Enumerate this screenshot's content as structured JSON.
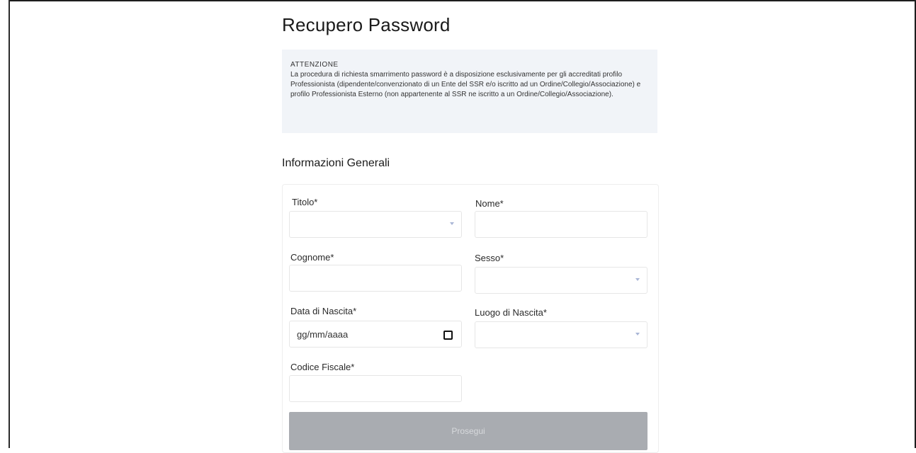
{
  "page": {
    "title": "Recupero Password"
  },
  "alert": {
    "title": "ATTENZIONE",
    "text": "La procedura di richiesta smarrimento password è a disposizione esclusivamente per gli accreditati profilo Professionista (dipendente/convenzionato di un Ente del SSR e/o iscritto ad un Ordine/Collegio/Associazione) e profilo Professionista Esterno (non appartenente al SSR ne iscritto a un Ordine/Collegio/Associazione)."
  },
  "section": {
    "title": "Informazioni Generali"
  },
  "form": {
    "titolo": {
      "label": "Titolo*",
      "value": ""
    },
    "nome": {
      "label": "Nome*",
      "value": ""
    },
    "cognome": {
      "label": "Cognome*",
      "value": ""
    },
    "sesso": {
      "label": "Sesso*",
      "value": ""
    },
    "data_nascita": {
      "label": "Data di Nascita*",
      "value": "gg/mm/aaaa"
    },
    "luogo_nascita": {
      "label": "Luogo di Nascita*",
      "value": ""
    },
    "codice_fiscale": {
      "label": "Codice Fiscale*",
      "value": ""
    },
    "submit_label": "Prosegui"
  },
  "colors": {
    "alert_background": "#f1f4f8",
    "button_disabled": "#a9acb1",
    "select_arrow": "#a9b6d6"
  }
}
